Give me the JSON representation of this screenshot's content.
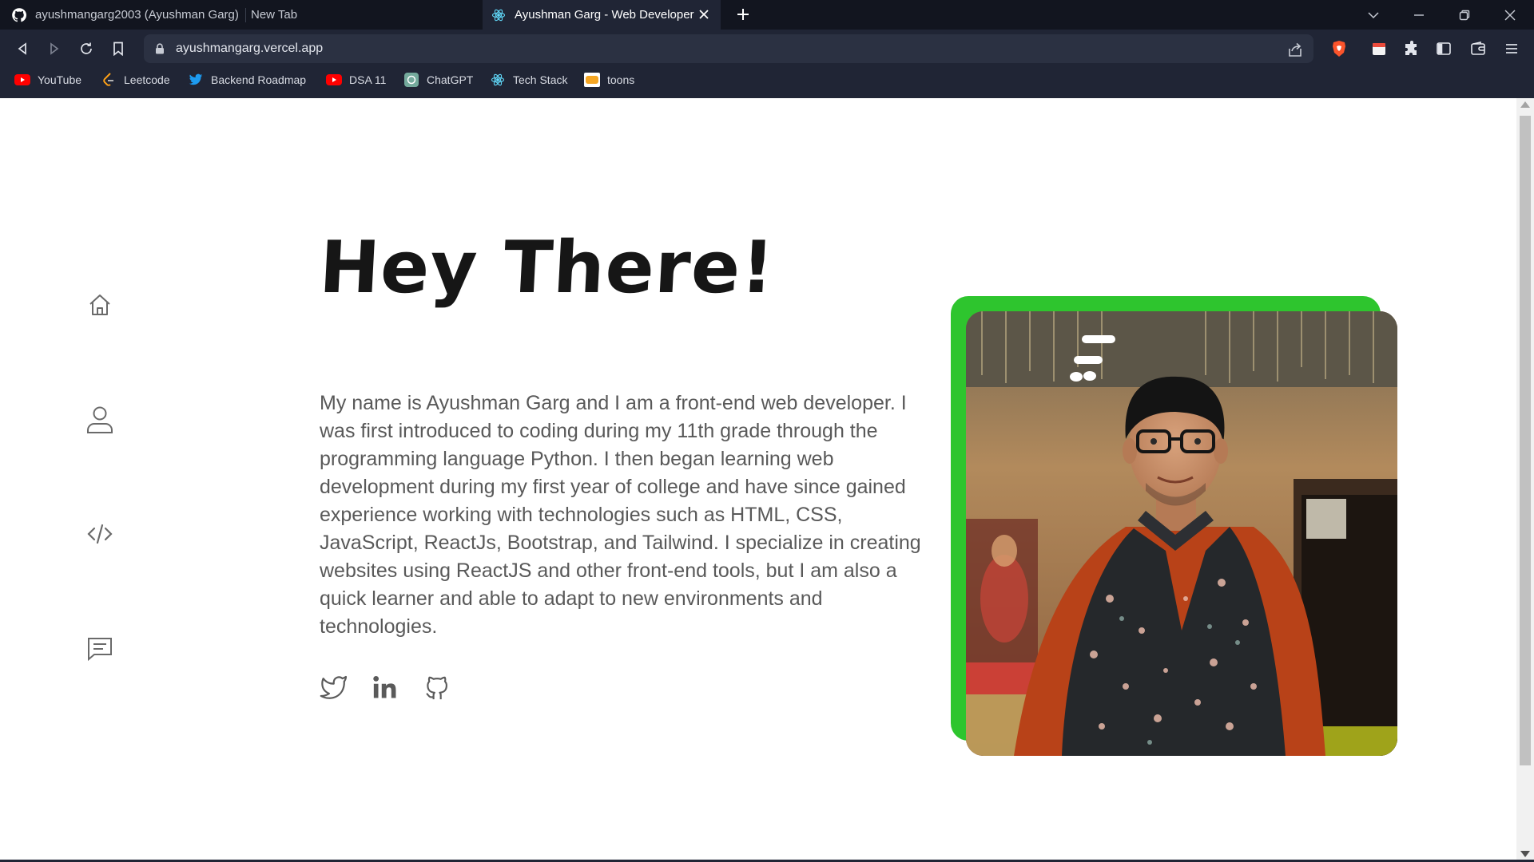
{
  "browser": {
    "tabs": [
      {
        "title": "ayushmangarg2003 (Ayushman Garg)",
        "icon": "github-icon"
      },
      {
        "title": "New Tab",
        "icon": ""
      },
      {
        "title": "Ayushman Garg - Web Developer",
        "icon": "react-icon",
        "active": true
      }
    ],
    "url": "ayushmangarg.vercel.app",
    "bookmarks": [
      {
        "label": "YouTube",
        "icon": "youtube-icon"
      },
      {
        "label": "Leetcode",
        "icon": "leetcode-icon"
      },
      {
        "label": "Backend Roadmap",
        "icon": "twitter-icon"
      },
      {
        "label": "DSA 11",
        "icon": "youtube-icon"
      },
      {
        "label": "ChatGPT",
        "icon": "chatgpt-icon"
      },
      {
        "label": "Tech Stack",
        "icon": "react-icon"
      },
      {
        "label": "toons",
        "icon": "toons-icon"
      }
    ]
  },
  "page": {
    "title": "Hey There!",
    "bio": "My name is Ayushman Garg and I am a front-end web developer. I was first introduced to coding during my 11th grade through the programming language Python. I then began learning web development during my first year of college and have since gained experience working with technologies such as HTML, CSS, JavaScript, ReactJs, Bootstrap, and Tailwind. I specialize in creating websites using ReactJS and other front-end tools, but I am also a quick learner and able to adapt to new environments and technologies.",
    "side_nav": [
      "home-icon",
      "user-icon",
      "code-icon",
      "message-icon"
    ],
    "social": [
      "twitter-icon",
      "linkedin-icon",
      "github-icon"
    ],
    "accent_color": "#2ec52e"
  }
}
